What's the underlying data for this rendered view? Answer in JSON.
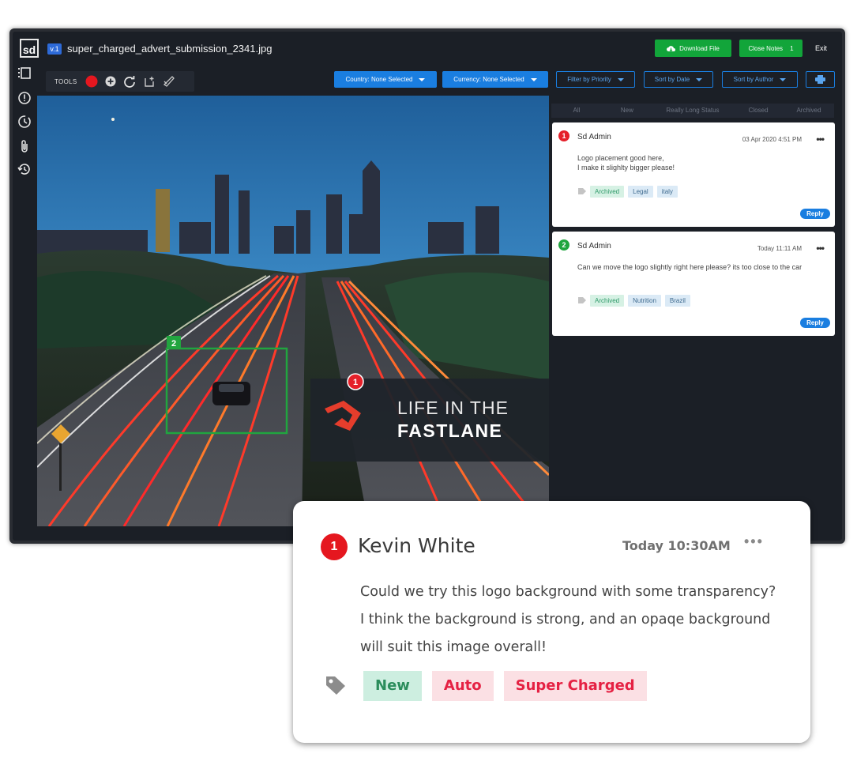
{
  "header": {
    "logo": "sd",
    "version": "v.1",
    "filename": "super_charged_advert_submission_2341.jpg",
    "download_label": "Download File",
    "close_notes_label": "Close Notes",
    "close_notes_count": "1",
    "exit_label": "Exit"
  },
  "sidebar": {
    "items": [
      "layout-icon",
      "alert-circle-icon",
      "history-icon",
      "attachment-icon",
      "restore-icon"
    ]
  },
  "toolbar": {
    "tools_label": "TOOLS",
    "record_color": "#e5171f"
  },
  "filters": {
    "country": "Country: None Selected",
    "currency": "Currency: None Selected",
    "priority": "Filter by Priority",
    "date": "Sort by Date",
    "author": "Sort by Author"
  },
  "status_tabs": [
    "All",
    "New",
    "Really Long Status",
    "Closed",
    "Archived"
  ],
  "canvas": {
    "markers": [
      {
        "number": "1",
        "color": "#e5202a"
      },
      {
        "number": "2",
        "color": "#21a53f"
      }
    ],
    "overlay": {
      "line1": "LIFE IN THE",
      "line2": "FASTLANE"
    }
  },
  "notes": [
    {
      "number": "1",
      "author": "Sd Admin",
      "time": "03 Apr 2020 4:51 PM",
      "body_line1": "Logo placement good here,",
      "body_line2": "I make it slighlty bigger please!",
      "tags": [
        "Archived",
        "Legal",
        "italy"
      ],
      "reply": "Reply"
    },
    {
      "number": "2",
      "author": "Sd Admin",
      "time": "Today 11:11 AM",
      "body_line1": "Can we move the logo slightly right here please? its too close to the car",
      "body_line2": "",
      "tags": [
        "Archived",
        "Nutrition",
        "Brazil"
      ],
      "reply": "Reply"
    }
  ],
  "popup": {
    "number": "1",
    "author": "Kevin White",
    "time": "Today 10:30AM",
    "line1": "Could we try this logo background with some transparency?",
    "line2": "I think the background is strong, and an opaqe background",
    "line3": "will suit this image overall!",
    "tags": [
      "New",
      "Auto",
      "Super Charged"
    ]
  },
  "colors": {
    "accent_blue": "#1a7ee0",
    "accent_green": "#12a53a",
    "app_bg": "#1b1f26"
  }
}
